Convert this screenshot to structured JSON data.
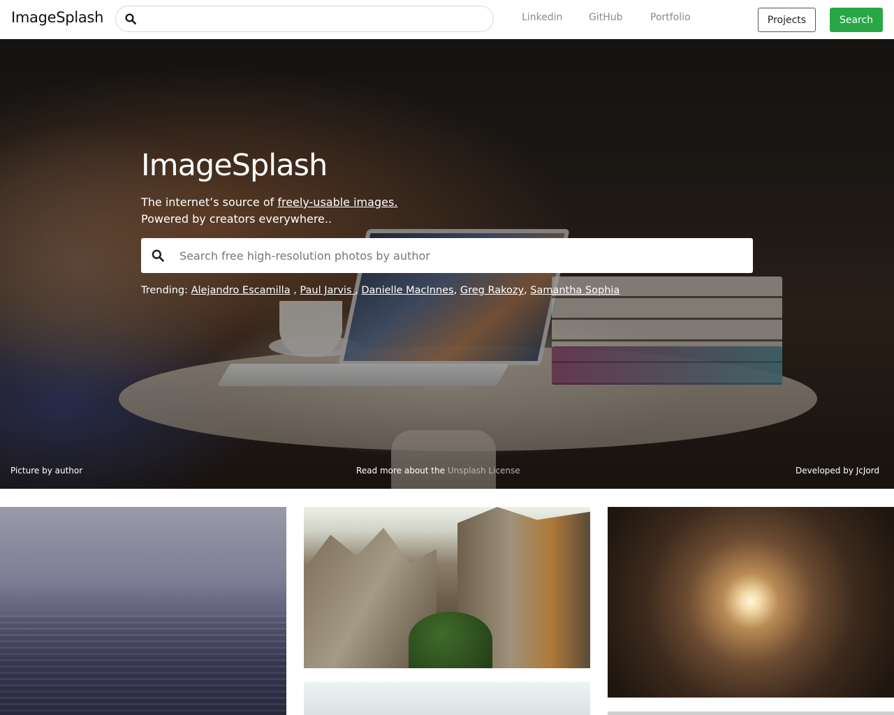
{
  "navbar": {
    "brand": "ImageSplash",
    "search": {
      "value": "",
      "placeholder": ""
    },
    "links": [
      "Linkedin",
      "GitHub",
      "Portfolio"
    ],
    "projects_label": "Projects",
    "search_label": "Search"
  },
  "hero": {
    "title": "ImageSplash",
    "subtitle_prefix": "The internet’s source of ",
    "subtitle_link": "freely-usable images.",
    "subtitle_line2": "Powered by creators everywhere..",
    "search_placeholder": "Search free high-resolution photos by author",
    "trending_label": "Trending:",
    "trending": [
      {
        "name": "Alejandro Escamilla",
        "sep": " ,"
      },
      {
        "name": "Paul Jarvis ",
        "sep": ","
      },
      {
        "name": "Danielle MacInnes",
        "sep": ","
      },
      {
        "name": "Greg Rakozy",
        "sep": ","
      },
      {
        "name": "Samantha Sophia",
        "sep": ""
      }
    ],
    "footer": {
      "picture_credit": "Picture by author",
      "license_prefix": "Read more about the ",
      "license_link": "Unsplash License",
      "developed_by": "Developed by JcJord"
    }
  },
  "icons": {
    "nav_search": "search-icon",
    "hero_search": "search-icon"
  },
  "colors": {
    "accent": "#28a745",
    "license_link": "#b5b5b5"
  }
}
